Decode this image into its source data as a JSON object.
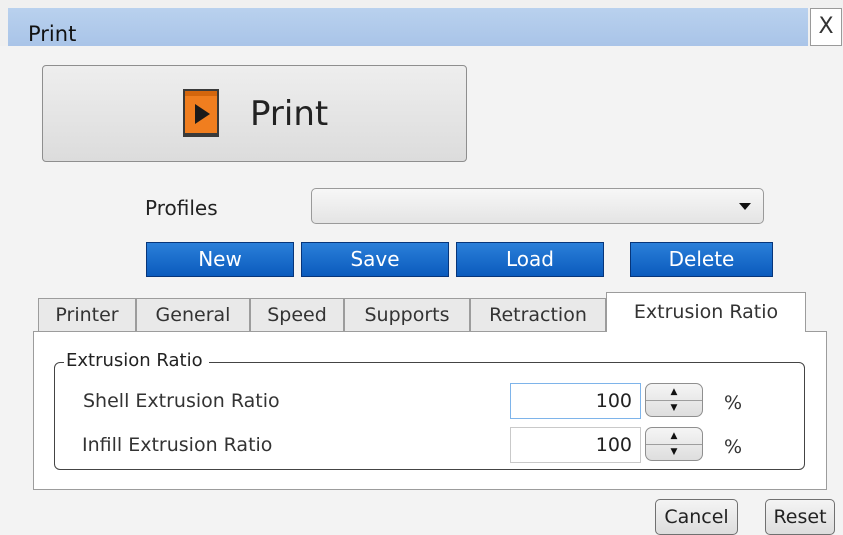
{
  "window": {
    "title": "Print",
    "close_label": "X"
  },
  "print_button": {
    "label": "Print",
    "icon": "play-media-icon"
  },
  "profiles": {
    "label": "Profiles",
    "selected": ""
  },
  "actions": {
    "new": "New",
    "save": "Save",
    "load": "Load",
    "delete": "Delete"
  },
  "tabs": [
    {
      "label": "Printer"
    },
    {
      "label": "General"
    },
    {
      "label": "Speed"
    },
    {
      "label": "Supports"
    },
    {
      "label": "Retraction"
    },
    {
      "label": "Extrusion Ratio"
    }
  ],
  "active_tab": "Extrusion Ratio",
  "extrusion_group": {
    "title": "Extrusion Ratio",
    "shell": {
      "label": "Shell Extrusion Ratio",
      "value": "100",
      "unit": "%"
    },
    "infill": {
      "label": "Infill Extrusion Ratio",
      "value": "100",
      "unit": "%"
    }
  },
  "footer": {
    "cancel": "Cancel",
    "reset": "Reset"
  },
  "colors": {
    "titlebar": "#aec7ea",
    "action_button": "#0d5fc1",
    "icon_orange": "#f07e1f"
  }
}
